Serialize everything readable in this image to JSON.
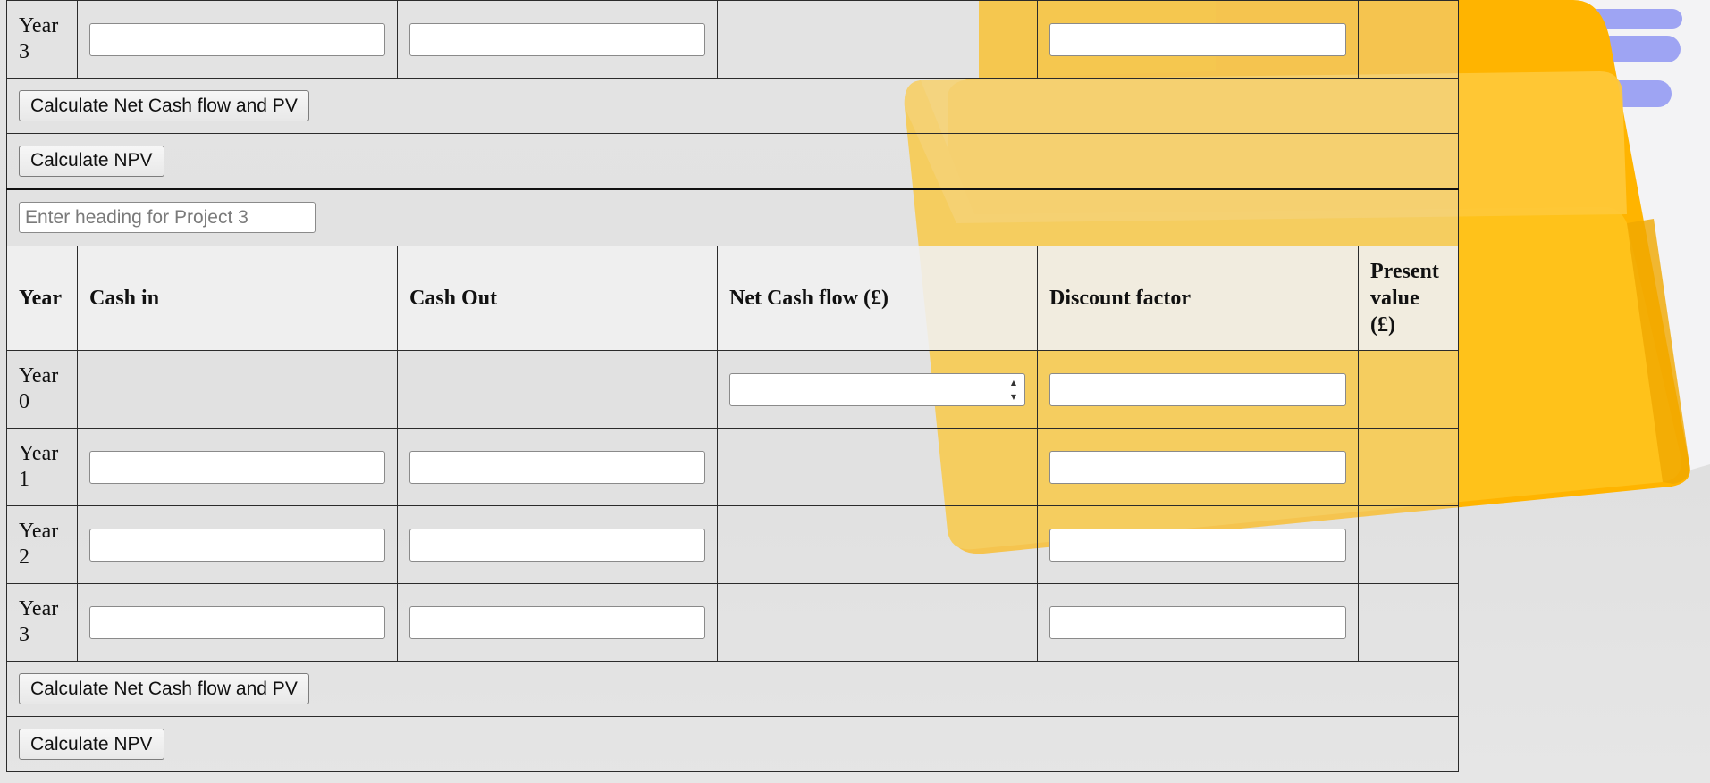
{
  "colors": {
    "folder_front": "#FFC21A",
    "folder_back": "#FFB800",
    "paper_lines": "#8E95F2",
    "page_background": "#E2E2E2"
  },
  "table": {
    "top_partial_row": {
      "year_label": "Year 3"
    },
    "buttons": {
      "calc_net_cash_flow_pv": "Calculate Net Cash flow and PV",
      "calc_npv": "Calculate NPV"
    },
    "project3": {
      "heading_input_placeholder": "Enter heading for Project 3",
      "headers": {
        "year": "Year",
        "cash_in": "Cash in",
        "cash_out": "Cash Out",
        "net_cash_flow": "Net Cash flow (£)",
        "discount_factor": "Discount factor",
        "present_value": "Present value (£)"
      },
      "rows": [
        {
          "year_label": "Year 0"
        },
        {
          "year_label": "Year 1"
        },
        {
          "year_label": "Year 2"
        },
        {
          "year_label": "Year 3"
        }
      ],
      "buttons": {
        "calc_net_cash_flow_pv": "Calculate Net Cash flow and PV",
        "calc_npv": "Calculate NPV"
      }
    }
  }
}
